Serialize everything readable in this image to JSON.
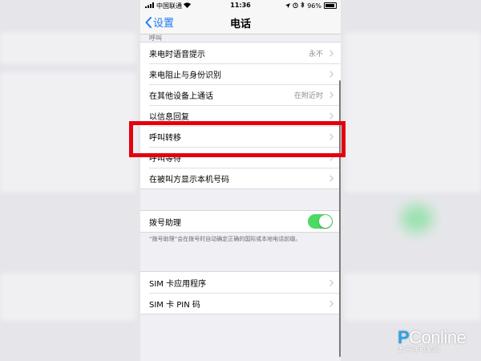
{
  "status_bar": {
    "carrier": "中国联通",
    "time": "11:36",
    "battery": "96%",
    "battery_level": 0.96
  },
  "nav": {
    "back_label": "设置",
    "title": "电话"
  },
  "calls_section": {
    "header": "呼叫",
    "rows": [
      {
        "label": "来电时语音提示",
        "detail": "永不"
      },
      {
        "label": "来电阻止与身份识别",
        "detail": ""
      },
      {
        "label": "在其他设备上通话",
        "detail": "在附近时"
      },
      {
        "label": "以信息回复",
        "detail": ""
      },
      {
        "label": "呼叫转移",
        "detail": ""
      },
      {
        "label": "呼叫等待",
        "detail": ""
      },
      {
        "label": "在被叫方显示本机号码",
        "detail": ""
      }
    ]
  },
  "dial_assist": {
    "label": "拨号助理",
    "enabled": true,
    "footnote": "“拨号助理”会在拨号时自动确定正确的国际或本地电话前缀。"
  },
  "sim_section": {
    "rows": [
      {
        "label": "SIM 卡应用程序"
      },
      {
        "label": "SIM 卡 PIN 码"
      }
    ]
  },
  "colors": {
    "accent": "#1e7cf2",
    "toggle_on": "#4cd964",
    "highlight": "#e3000f"
  },
  "watermark": {
    "brand_p": "P",
    "brand_rest": "Conline",
    "sub": "太平洋电脑网"
  }
}
